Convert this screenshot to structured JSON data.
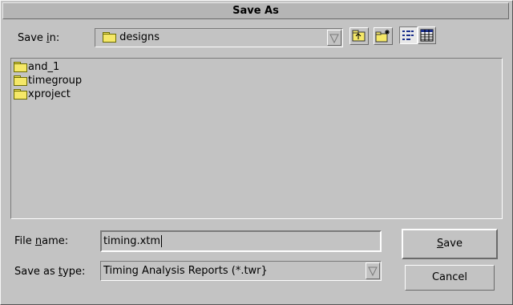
{
  "window": {
    "title": "Save As"
  },
  "save_in": {
    "label_pre": "Save ",
    "label_mnemonic": "i",
    "label_post": "n:",
    "value": "designs"
  },
  "toolbar": {
    "icons": [
      "up-one-level-icon",
      "create-new-folder-icon",
      "list-view-icon",
      "details-view-icon"
    ]
  },
  "files": [
    {
      "name": "and_1",
      "icon": "folder-icon"
    },
    {
      "name": "timegroup",
      "icon": "folder-icon"
    },
    {
      "name": "xproject",
      "icon": "folder-icon"
    }
  ],
  "file_name": {
    "label_pre": "File ",
    "label_mnemonic": "n",
    "label_post": "ame:",
    "value": "timing.xtm"
  },
  "save_as_type": {
    "label_pre": "Save as ",
    "label_mnemonic": "t",
    "label_post": "ype:",
    "value": "Timing Analysis Reports (*.twr}"
  },
  "buttons": {
    "save_mnemonic": "S",
    "save_rest": "ave",
    "cancel": "Cancel"
  },
  "colors": {
    "dialog_bg": "#c3c3c3",
    "folder_fill": "#f5e868",
    "list_bg": "#c3c3c3"
  }
}
